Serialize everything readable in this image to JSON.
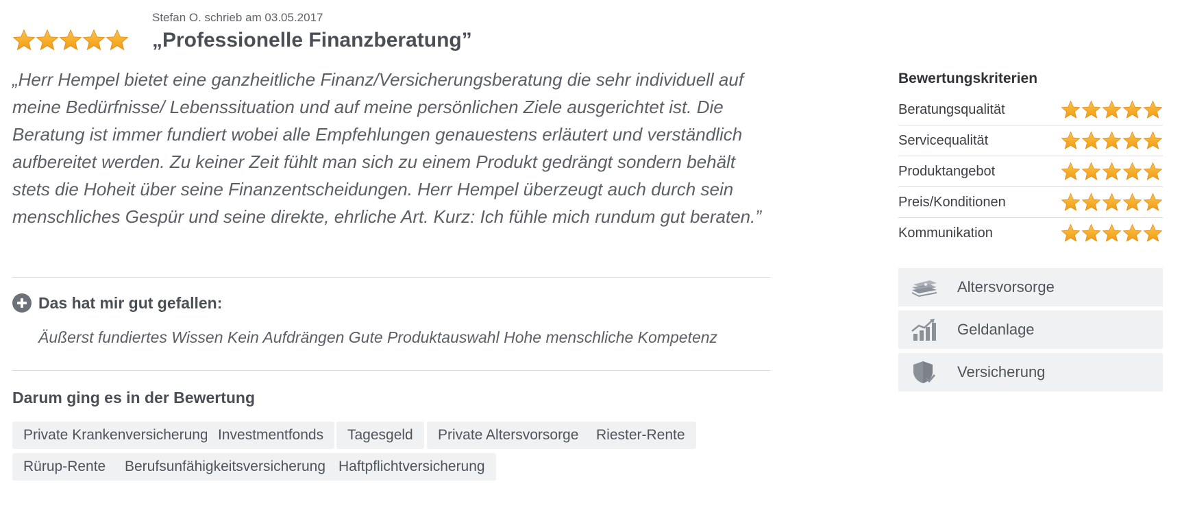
{
  "review": {
    "author_line": "Stefan O. schrieb am 03.05.2017",
    "rating": 5,
    "title": "„Professionelle Finanzberatung”",
    "quote": "„Herr Hempel bietet eine ganzheitliche Finanz/Versicherungsberatung die sehr individuell auf meine Bedürfnisse/ Lebenssituation und auf meine persönlichen Ziele ausgerichtet ist. Die Beratung ist immer fundiert wobei alle Empfehlungen genauestens erläutert und verständlich aufbereitet werden. Zu keiner Zeit fühlt man sich zu einem Produkt gedrängt sondern behält stets die Hoheit über seine Finanzentscheidungen. Herr Hempel überzeugt auch durch sein menschliches Gespür und seine direkte, ehrliche Art. Kurz: Ich fühle mich rundum gut beraten.”"
  },
  "liked": {
    "label": "Das hat mir gut gefallen:",
    "text": "Äußerst fundiertes Wissen Kein Aufdrängen Gute Produktauswahl Hohe menschliche Kompetenz"
  },
  "topics": {
    "label": "Darum ging es in der Bewertung",
    "tags": [
      "Private Krankenversicherung",
      "Investmentfonds",
      "Tagesgeld",
      "Private Altersvorsorge",
      "Riester-Rente",
      "Rürup-Rente",
      "Berufsunfähigkeitsversicherung",
      "Haftpflichtversicherung"
    ]
  },
  "criteria": {
    "label": "Bewertungskriterien",
    "items": [
      {
        "label": "Beratungsqualität",
        "rating": 5
      },
      {
        "label": "Servicequalität",
        "rating": 5
      },
      {
        "label": "Produktangebot",
        "rating": 5
      },
      {
        "label": "Preis/Konditionen",
        "rating": 5
      },
      {
        "label": "Kommunikation",
        "rating": 5
      }
    ]
  },
  "categories": [
    {
      "label": "Altersvorsorge",
      "icon": "money-stack-icon"
    },
    {
      "label": "Geldanlage",
      "icon": "growth-chart-icon"
    },
    {
      "label": "Versicherung",
      "icon": "shield-check-icon"
    }
  ],
  "colors": {
    "star": "#f39c12",
    "text": "#4a4f56",
    "chip_bg": "#f0f1f2",
    "icon": "#8a9199"
  }
}
